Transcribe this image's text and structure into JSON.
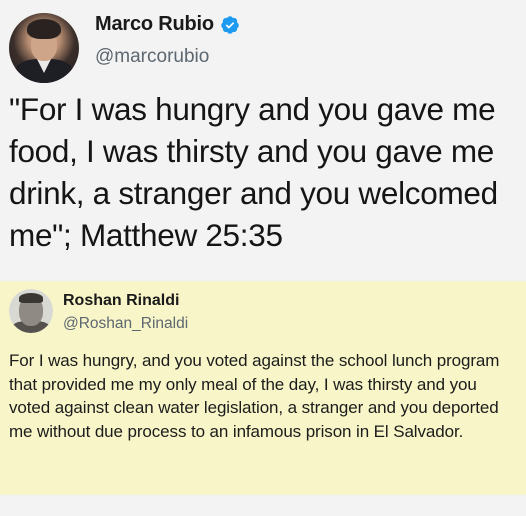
{
  "original_tweet": {
    "display_name": "Marco Rubio",
    "handle": "@marcorubio",
    "verified": true,
    "text": "\"For I was hungry and you gave me food, I was thirsty and you gave me drink, a stranger and you welcomed me\"; Matthew 25:35"
  },
  "reply_tweet": {
    "display_name": "Roshan Rinaldi",
    "handle": "@Roshan_Rinaldi",
    "text": "For I was hungry, and you voted against the school lunch program that provided me my only meal of the day, I was thirsty and you voted against clean water legislation, a stranger and you deported me without due process to an infamous prison in El Salvador."
  },
  "colors": {
    "verified_blue": "#1d9bf0",
    "highlight_yellow": "#f8f6c8",
    "background": "#f3f3f3",
    "handle_gray": "#5d6770"
  },
  "icons": {
    "verified": "verified-badge-icon"
  }
}
